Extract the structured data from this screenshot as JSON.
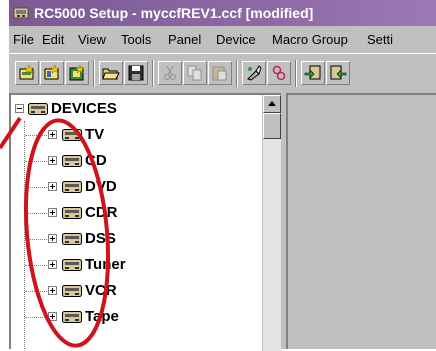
{
  "window": {
    "title": "RC5000 Setup - myccfREV1.ccf [modified]"
  },
  "menu": [
    "File",
    "Edit",
    "View",
    "Tools",
    "Panel",
    "Device",
    "Macro Group",
    "Setti"
  ],
  "tree": {
    "root_label": "DEVICES",
    "root_expander": "minus",
    "children": [
      {
        "label": "TV",
        "expander": "plus"
      },
      {
        "label": "CD",
        "expander": "plus"
      },
      {
        "label": "DVD",
        "expander": "plus"
      },
      {
        "label": "CDR",
        "expander": "plus"
      },
      {
        "label": "DSS",
        "expander": "plus"
      },
      {
        "label": "Tuner",
        "expander": "plus"
      },
      {
        "label": "VCR",
        "expander": "plus"
      },
      {
        "label": "Tape",
        "expander": "plus"
      }
    ]
  },
  "colors": {
    "titlebar": "#8d6aa6",
    "annotation": "#d0121c",
    "face": "#c0c0c0"
  },
  "toolbar_icons": [
    "new-device-icon",
    "new-panel-icon",
    "new-frame-icon",
    "open-icon",
    "save-icon",
    "cut-icon",
    "copy-icon",
    "paste-icon",
    "learn-icon",
    "rc5000-icon",
    "download-icon",
    "upload-icon"
  ]
}
